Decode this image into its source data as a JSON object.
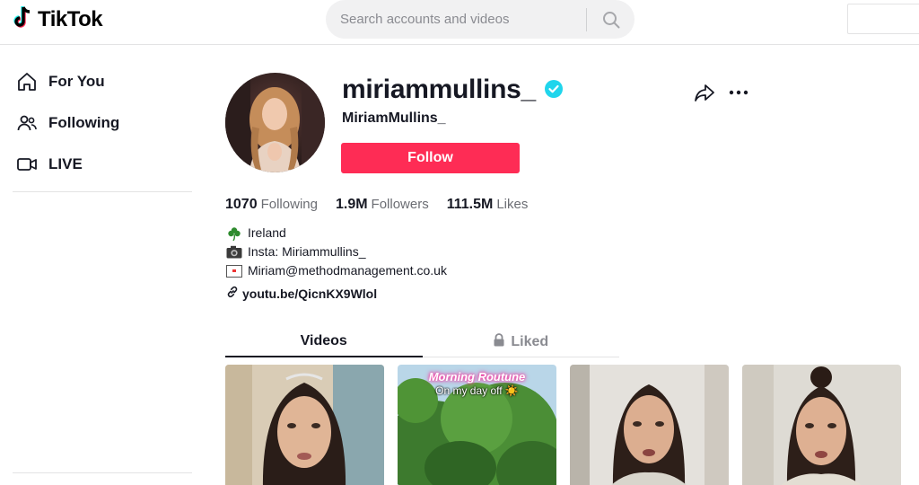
{
  "header": {
    "logo_text": "TikTok",
    "search_placeholder": "Search accounts and videos"
  },
  "sidebar": {
    "items": [
      {
        "label": "For You",
        "icon": "home-icon"
      },
      {
        "label": "Following",
        "icon": "users-icon"
      },
      {
        "label": "LIVE",
        "icon": "live-icon"
      }
    ]
  },
  "profile": {
    "username": "miriammullins_",
    "verified": true,
    "nickname": "MiriamMullins_",
    "follow_label": "Follow",
    "stats": [
      {
        "value": "1070",
        "label": "Following"
      },
      {
        "value": "1.9M",
        "label": "Followers"
      },
      {
        "value": "111.5M",
        "label": "Likes"
      }
    ],
    "bio": [
      {
        "icon": "shamrock-icon",
        "text": "Ireland"
      },
      {
        "icon": "camera-icon",
        "text": "Insta: Miriammullins_"
      },
      {
        "icon": "envelope-icon",
        "text": "Miriam@methodmanagement.co.uk"
      }
    ],
    "link": "youtu.be/QicnKX9Wlol"
  },
  "tabs": [
    {
      "label": "Videos",
      "active": true
    },
    {
      "label": "Liked",
      "active": false,
      "locked": true
    }
  ],
  "videos": [
    {
      "title": "",
      "subtitle": ""
    },
    {
      "title": "Morning Routune",
      "subtitle": "On my day off ☀️"
    },
    {
      "title": "",
      "subtitle": ""
    },
    {
      "title": "",
      "subtitle": ""
    }
  ],
  "colors": {
    "accent": "#fe2c55",
    "verified": "#20d5ec",
    "text": "#161823",
    "muted": "#6b6d73"
  }
}
